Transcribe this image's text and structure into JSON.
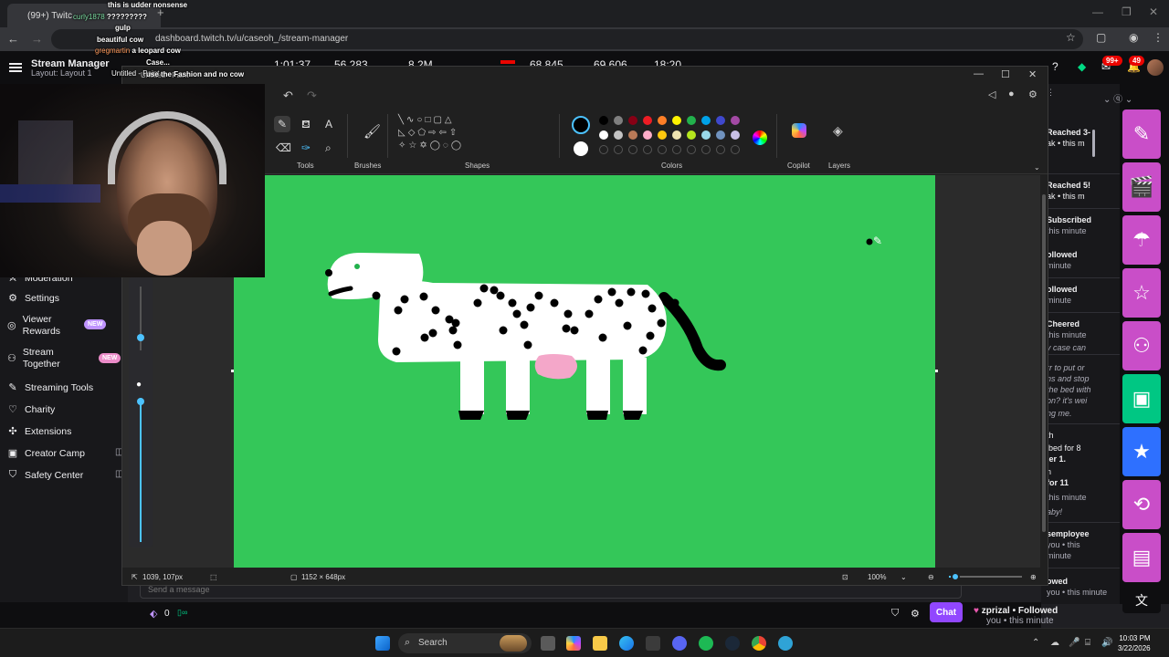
{
  "browser": {
    "tab_title": "(99+) Twitc",
    "url": "dashboard.twitch.tv/u/caseoh_/stream-manager"
  },
  "overlay_chat": [
    {
      "user": "",
      "text": "this is udder nonsense"
    },
    {
      "user": "curly1878",
      "text": "?????????"
    },
    {
      "user": "",
      "text": "gulp"
    },
    {
      "user": "",
      "text": "beautiful cow"
    },
    {
      "user": "gregmartin",
      "text": "a leopard cow"
    },
    {
      "user": "",
      "text": "Case..."
    },
    {
      "user": "",
      "text": "Untitled - Paint"
    },
    {
      "user": "",
      "text": "use the Fashion and no cow"
    }
  ],
  "stream_manager": {
    "title": "Stream Manager",
    "layout": "Layout 1",
    "stats": [
      "1:01:37",
      "56,283",
      "8.2M",
      "68,845",
      "69,606",
      "18:20"
    ],
    "notif_badge": "99+",
    "inbox_badge": "49"
  },
  "sidebar": {
    "items": [
      {
        "label": "Moderation",
        "icon": "sword-icon"
      },
      {
        "label": "Settings",
        "icon": "gear-icon"
      },
      {
        "label": "Viewer Rewards",
        "icon": "reward-icon",
        "badge": "NEW"
      },
      {
        "label": "Stream Together",
        "icon": "people-icon",
        "badge": "NEW"
      },
      {
        "label": "Streaming Tools",
        "icon": "tools-icon"
      },
      {
        "label": "Charity",
        "icon": "heart-icon"
      },
      {
        "label": "Extensions",
        "icon": "puzzle-icon"
      },
      {
        "label": "Creator Camp",
        "icon": "book-icon"
      },
      {
        "label": "Safety Center",
        "icon": "shield-icon"
      }
    ]
  },
  "paint": {
    "title": "Untitled - Paint",
    "ribbon": {
      "tools_label": "Tools",
      "brushes_label": "Brushes",
      "shapes_label": "Shapes",
      "colors_label": "Colors",
      "copilot_label": "Copilot",
      "layers_label": "Layers"
    },
    "palette_row1": [
      "#000000",
      "#7f7f7f",
      "#880015",
      "#ed1c24",
      "#ff7f27",
      "#fff200",
      "#22b14c",
      "#00a2e8",
      "#3f48cc",
      "#a349a4"
    ],
    "palette_row2": [
      "#ffffff",
      "#c3c3c3",
      "#b97a57",
      "#ffaec9",
      "#ffc90e",
      "#efe4b0",
      "#b5e61d",
      "#99d9ea",
      "#7092be",
      "#c8bfe7"
    ],
    "canvas_bg": "#34c759",
    "status": {
      "cursor": "1039, 107px",
      "size": "1152 × 648px",
      "zoom": "100%"
    }
  },
  "right_chat": {
    "lines": [
      {
        "t": "Reached 3-",
        "s": "b"
      },
      {
        "t": "ak • this m",
        "s": ""
      },
      {
        "t": "Reached 5!",
        "s": "b"
      },
      {
        "t": "ak • this m",
        "s": ""
      },
      {
        "t": "Subscribed",
        "s": "b"
      },
      {
        "t": "this minute",
        "s": "g"
      },
      {
        "t": "ollowed",
        "s": "b"
      },
      {
        "t": "minute",
        "s": "g"
      },
      {
        "t": "ollowed",
        "s": "b"
      },
      {
        "t": "minute",
        "s": "g"
      },
      {
        "t": "Cheered",
        "s": "b"
      },
      {
        "t": "this minute",
        "s": "g"
      },
      {
        "t": "y case can",
        "s": "i"
      },
      {
        "t": "rr to put or",
        "s": "i"
      },
      {
        "t": "ns and stop",
        "s": "i"
      },
      {
        "t": "the bed with",
        "s": "i"
      },
      {
        "t": "on? it's wei",
        "s": "i"
      },
      {
        "t": "ng me.",
        "s": "i"
      },
      {
        "t": "th",
        "s": ""
      },
      {
        "t": "ibed for 8",
        "s": ""
      },
      {
        "t": "ier 1.",
        "s": "b"
      },
      {
        "t": "n",
        "s": ""
      },
      {
        "t": "for 11",
        "s": "b"
      },
      {
        "t": "this minute",
        "s": "g"
      },
      {
        "t": "aby!",
        "s": "i"
      },
      {
        "t": "semployee",
        "s": "b"
      },
      {
        "t": "you • this",
        "s": "g"
      },
      {
        "t": "minute",
        "s": "g"
      },
      {
        "t": "owed",
        "s": "b"
      },
      {
        "t": "you • this minute",
        "s": "g"
      }
    ]
  },
  "bottom": {
    "message_placeholder": "Send a message",
    "points": "0",
    "chat_button": "Chat",
    "follow_user": "zprizal • Followed",
    "follow_time": "you • this minute"
  },
  "taskbar": {
    "search_placeholder": "Search",
    "time": "10:03 PM",
    "date": "3/22/2026"
  }
}
